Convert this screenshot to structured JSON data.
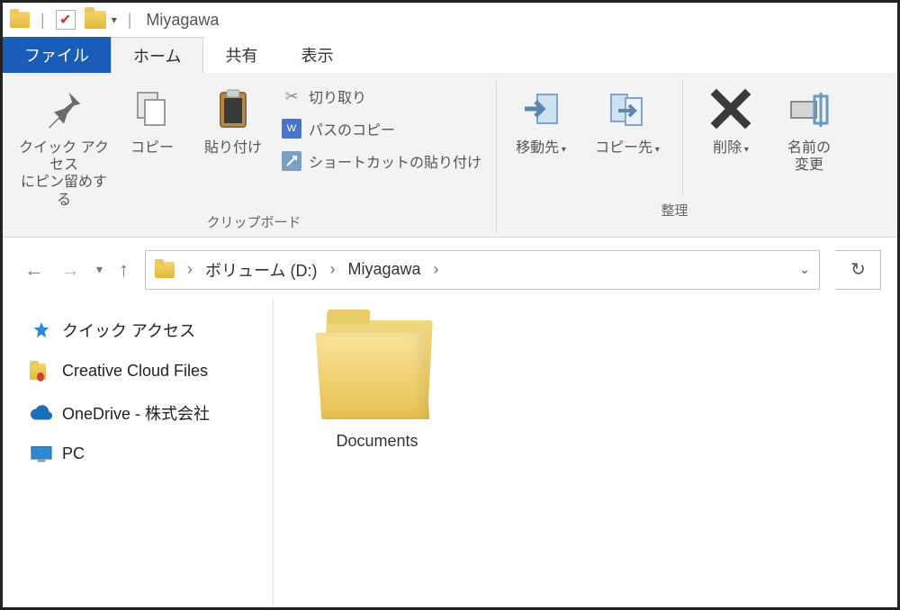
{
  "title_bar": {
    "window_title": "Miyagawa"
  },
  "tabs": {
    "file": "ファイル",
    "home": "ホーム",
    "share": "共有",
    "view": "表示"
  },
  "ribbon": {
    "clipboard": {
      "title": "クリップボード",
      "pin": "クイック アクセス\nにピン留めする",
      "copy": "コピー",
      "paste": "貼り付け",
      "cut": "切り取り",
      "copy_path": "パスのコピー",
      "paste_shortcut": "ショートカットの貼り付け"
    },
    "organize": {
      "title": "整理",
      "move_to": "移動先",
      "copy_to": "コピー先",
      "delete": "削除",
      "rename": "名前の\n変更"
    }
  },
  "breadcrumb": {
    "seg1": "ボリューム (D:)",
    "seg2": "Miyagawa"
  },
  "side_nav": {
    "quick_access": "クイック アクセス",
    "creative_cloud": "Creative Cloud Files",
    "onedrive": "OneDrive - 株式会社",
    "pc": "PC"
  },
  "files": {
    "item1": "Documents"
  }
}
